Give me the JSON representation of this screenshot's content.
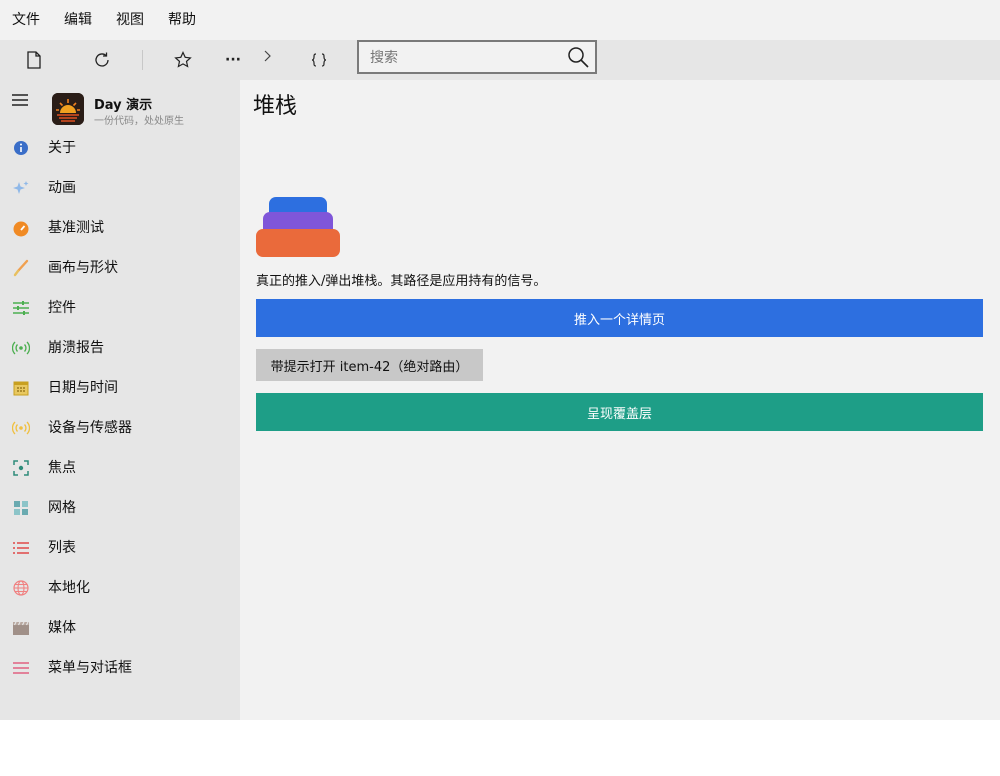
{
  "menubar": {
    "items": [
      "文件",
      "编辑",
      "视图",
      "帮助"
    ]
  },
  "toolbar": {
    "search_placeholder": "搜索",
    "more_label": "···",
    "icons": [
      "document-icon",
      "refresh-icon",
      "star-icon",
      "more-icon",
      "chevron-right-icon",
      "braces-icon",
      "search-icon"
    ]
  },
  "sidebar": {
    "app_title": "Day 演示",
    "app_subtitle": "一份代码，处处原生",
    "items": [
      {
        "label": "关于",
        "icon": "info-icon",
        "color": "#3a6ec8"
      },
      {
        "label": "动画",
        "icon": "sparkle-icon",
        "color": "#8fb8e8"
      },
      {
        "label": "基准测试",
        "icon": "speedometer-icon",
        "color": "#f08a24"
      },
      {
        "label": "画布与形状",
        "icon": "brush-icon",
        "color": "#f0a050"
      },
      {
        "label": "控件",
        "icon": "sliders-icon",
        "color": "#4caf50"
      },
      {
        "label": "崩溃报告",
        "icon": "broadcast-icon",
        "color": "#4caf50"
      },
      {
        "label": "日期与时间",
        "icon": "calendar-icon",
        "color": "#c8a020"
      },
      {
        "label": "设备与传感器",
        "icon": "sensor-icon",
        "color": "#f0c040"
      },
      {
        "label": "焦点",
        "icon": "focus-icon",
        "color": "#2e8b7a"
      },
      {
        "label": "网格",
        "icon": "grid-icon",
        "color": "#6aaab0"
      },
      {
        "label": "列表",
        "icon": "list-icon",
        "color": "#e04848"
      },
      {
        "label": "本地化",
        "icon": "globe-icon",
        "color": "#f08080"
      },
      {
        "label": "媒体",
        "icon": "clapperboard-icon",
        "color": "#a09088"
      },
      {
        "label": "菜单与对话框",
        "icon": "menu-lines-icon",
        "color": "#e06080"
      }
    ]
  },
  "main": {
    "title": "堆栈",
    "description": "真正的推入/弹出堆栈。其路径是应用持有的信号。",
    "push_button": "推入一个详情页",
    "open_button": "带提示打开 item-42（绝对路由）",
    "overlay_button": "呈现覆盖层",
    "colors": {
      "primary": "#2d6fe0",
      "teal": "#1e9e87",
      "gray": "#c8c8c8"
    }
  }
}
